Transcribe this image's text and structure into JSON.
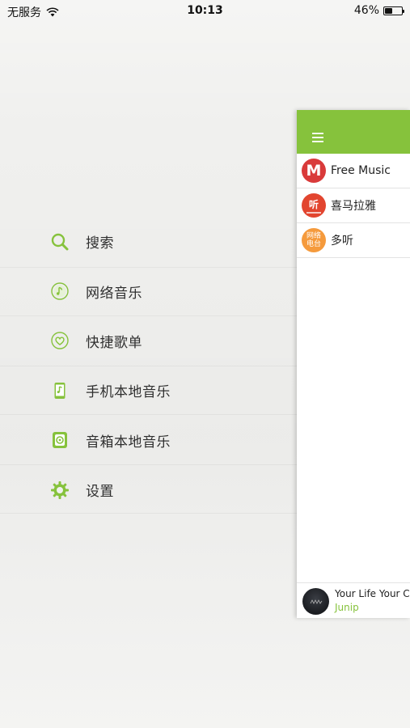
{
  "status": {
    "carrier": "无服务",
    "time": "10:13",
    "battery_percent": "46%",
    "battery_level": 0.46
  },
  "menu": {
    "items": [
      {
        "label": "搜索",
        "icon": "search-icon"
      },
      {
        "label": "网络音乐",
        "icon": "music-disc-icon"
      },
      {
        "label": "快捷歌单",
        "icon": "heart-icon"
      },
      {
        "label": "手机本地音乐",
        "icon": "phone-music-icon"
      },
      {
        "label": "音箱本地音乐",
        "icon": "speaker-icon"
      },
      {
        "label": "设置",
        "icon": "gear-icon"
      }
    ]
  },
  "panel": {
    "sources": [
      {
        "label": "Free Music",
        "icon": "free-music-logo",
        "avatar_text": "M",
        "color": "#d93a3a"
      },
      {
        "label": "喜马拉雅",
        "icon": "ximalaya-logo",
        "avatar_text": "听",
        "color": "#e2452f"
      },
      {
        "label": "多听",
        "icon": "duoting-logo",
        "avatar_text": "网络电台",
        "color": "#f59a3c"
      }
    ],
    "now_playing": {
      "title": "Your Life Your Call",
      "artist": "Junip"
    }
  },
  "colors": {
    "accent": "#86c23c",
    "menu_text": "#2f2f2f"
  }
}
